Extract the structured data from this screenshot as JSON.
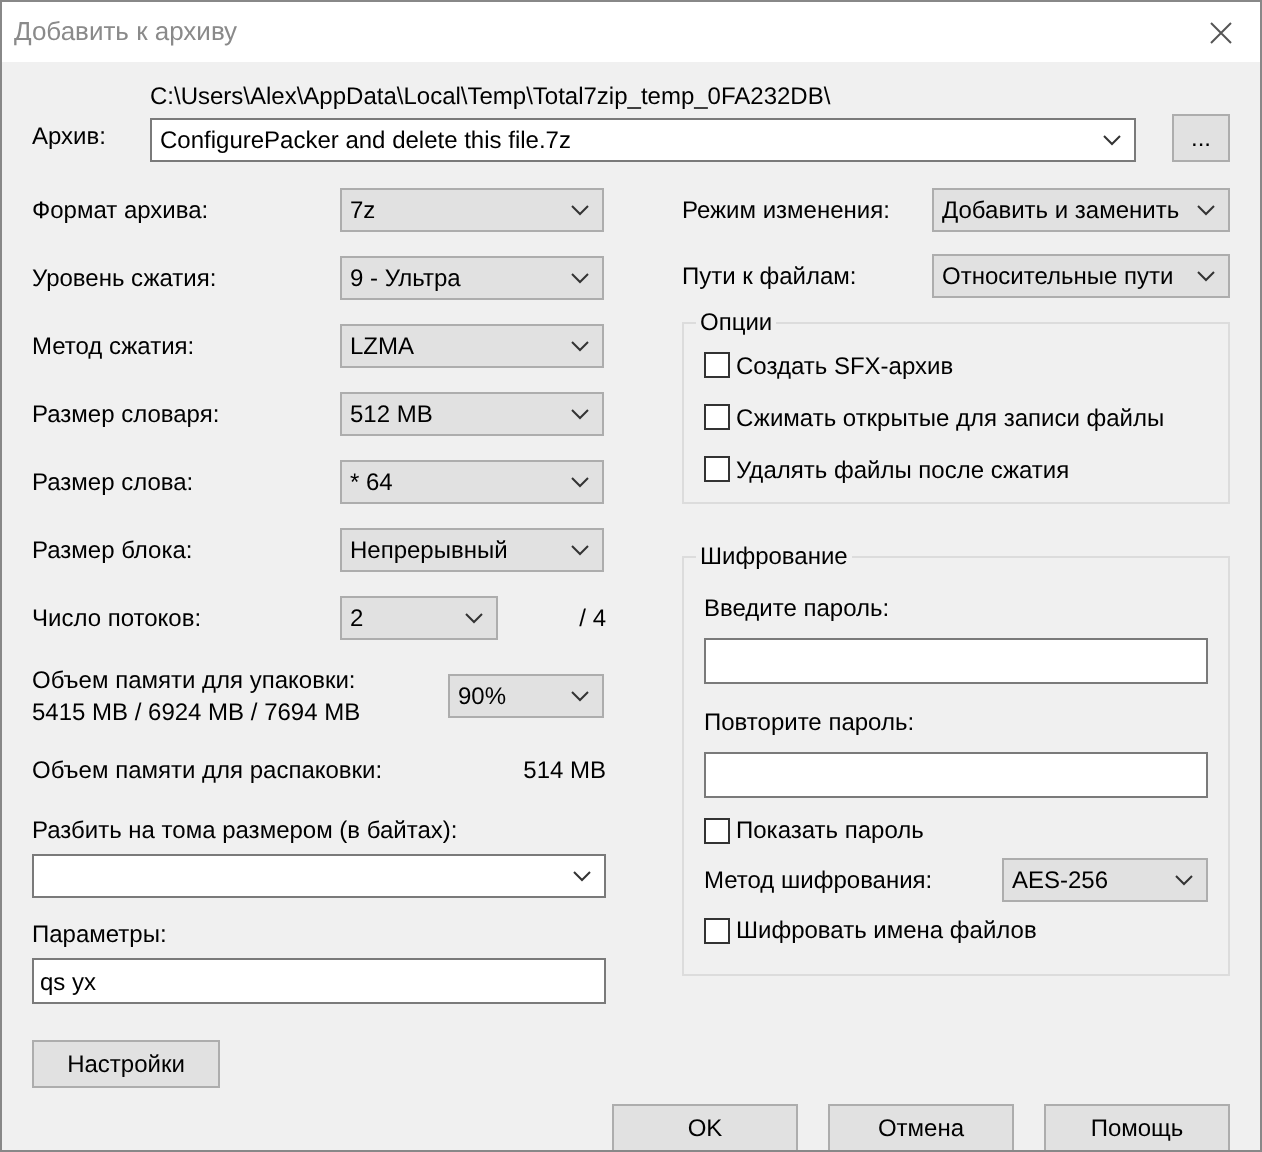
{
  "window": {
    "title": "Добавить к архиву"
  },
  "archive": {
    "label": "Архив:",
    "path": "C:\\Users\\Alex\\AppData\\Local\\Temp\\Total7zip_temp_0FA232DB\\",
    "value": "ConfigurePacker and delete this file.7z",
    "browse": "..."
  },
  "parameters": [
    {
      "kind": "combo",
      "label": "Формат архива:",
      "value": "7z"
    },
    {
      "kind": "combo",
      "label": "Уровень сжатия:",
      "value": "9 - Ультра"
    },
    {
      "kind": "combo",
      "label": "Метод сжатия:",
      "value": "LZMA"
    },
    {
      "kind": "combo",
      "label": "Размер словаря:",
      "value": "512 MB"
    },
    {
      "kind": "combo",
      "label": "Размер слова:",
      "value": "* 64"
    },
    {
      "kind": "combo",
      "label": "Размер блока:",
      "value": "Непрерывный"
    },
    {
      "kind": "threads",
      "label": "Число потоков:",
      "value": "2",
      "note": "/ 4"
    },
    {
      "kind": "memory",
      "label": "Объем памяти для упаковки:",
      "detail": "5415 MB / 6924 MB / 7694 MB",
      "value": "90%"
    },
    {
      "kind": "info",
      "label": "Объем памяти для распаковки:",
      "value": "514 MB"
    }
  ],
  "split": {
    "label": "Разбить на тома размером (в байтах):"
  },
  "params": {
    "label": "Параметры:",
    "value": "qs yx"
  },
  "settings_button": "Настройки",
  "modes": [
    {
      "label": "Режим изменения:",
      "value": "Добавить и заменить"
    },
    {
      "label": "Пути к файлам:",
      "value": "Относительные пути"
    }
  ],
  "options": {
    "title": "Опции",
    "items": [
      {
        "label": "Создать SFX-архив",
        "checked": false
      },
      {
        "label": "Сжимать открытые для записи файлы",
        "checked": false
      },
      {
        "label": "Удалять файлы после сжатия",
        "checked": false
      }
    ]
  },
  "encryption": {
    "title": "Шифрование",
    "password_label": "Введите пароль:",
    "confirm_label": "Повторите пароль:",
    "show_password": {
      "label": "Показать пароль",
      "checked": false
    },
    "method_label": "Метод шифрования:",
    "method_value": "AES-256",
    "encrypt_names": {
      "label": "Шифровать имена файлов",
      "checked": false
    }
  },
  "buttons": [
    "OK",
    "Отмена",
    "Помощь"
  ]
}
